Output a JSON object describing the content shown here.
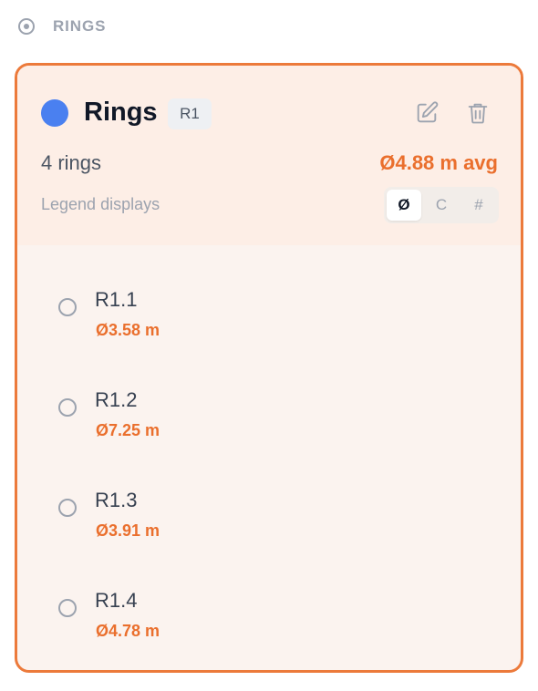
{
  "section": {
    "title": "RINGS",
    "icon": "radio-target-icon"
  },
  "group": {
    "name": "Rings",
    "badge": "R1",
    "color": "#4a80f0",
    "count_text": "4 rings",
    "avg_text": "Ø4.88 m avg",
    "legend_label": "Legend displays",
    "legend_options": [
      {
        "label": "Ø",
        "active": true
      },
      {
        "label": "C",
        "active": false
      },
      {
        "label": "#",
        "active": false
      }
    ],
    "edit_icon": "pencil-square-icon",
    "delete_icon": "trash-icon"
  },
  "rings": [
    {
      "name": "R1.1",
      "diameter": "Ø3.58 m"
    },
    {
      "name": "R1.2",
      "diameter": "Ø7.25 m"
    },
    {
      "name": "R1.3",
      "diameter": "Ø3.91 m"
    },
    {
      "name": "R1.4",
      "diameter": "Ø4.78 m"
    }
  ],
  "colors": {
    "accent": "#ec7a3b",
    "accent_text": "#ea6f2d",
    "card_bg": "#fbf3ef",
    "card_head_bg": "#fdeee6"
  }
}
